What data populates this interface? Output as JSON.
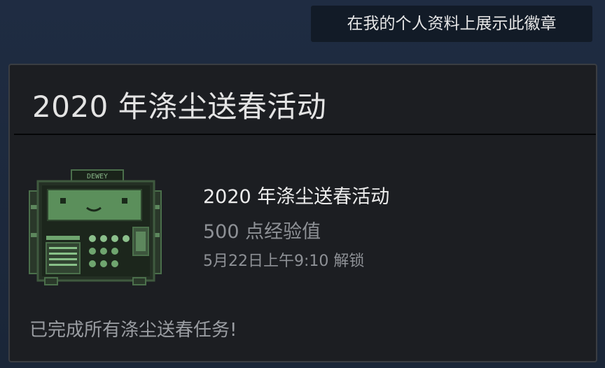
{
  "header": {
    "show_on_profile_label": "在我的个人资料上展示此徽章"
  },
  "card": {
    "title": "2020 年涤尘送春活动",
    "badge": {
      "image_icon": "dewey-robot-badge-icon",
      "image_text": "DEWEY",
      "name": "2020 年涤尘送春活动",
      "xp": "500 点经验值",
      "unlocked": "5月22日上午9:10 解锁",
      "description": "已完成所有涤尘送春任务!"
    }
  },
  "colors": {
    "page_background": "#1d2a3e",
    "card_background": "#1c1e22",
    "button_background": "#121b27",
    "primary_text": "#e4e4e4",
    "secondary_text": "#8e9196",
    "badge_green": "#7fbf7f"
  }
}
